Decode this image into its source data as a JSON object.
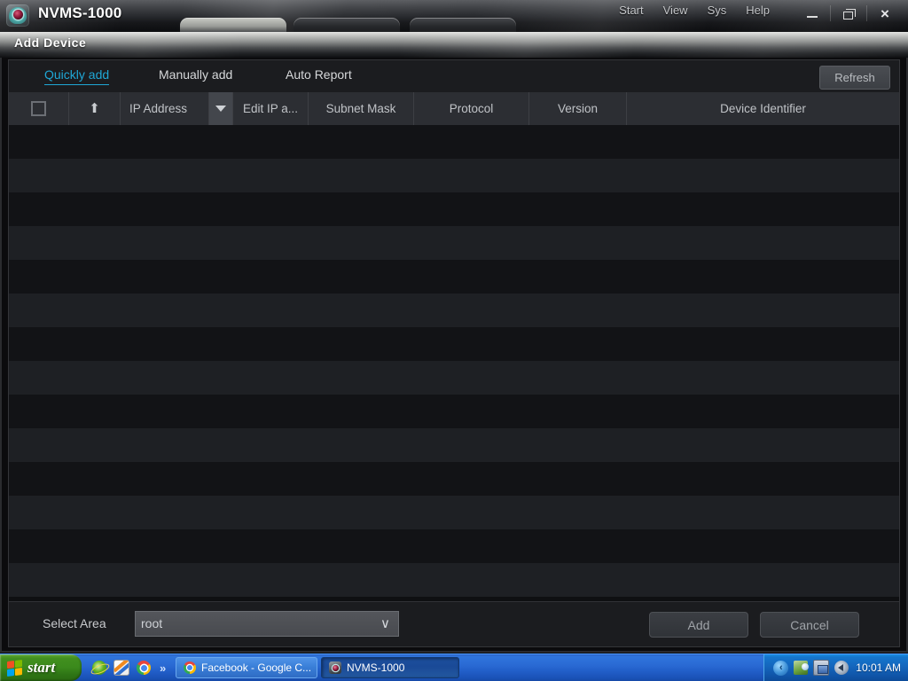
{
  "app": {
    "title": "NVMS-1000",
    "icon": "camera-icon",
    "menu": [
      {
        "label": "Start"
      },
      {
        "label": "View"
      },
      {
        "label": "Sys"
      },
      {
        "label": "Help"
      }
    ],
    "window_controls": {
      "minimize": "minimize-icon",
      "restore": "restore-icon",
      "close": "×"
    }
  },
  "dialog": {
    "title": "Add Device",
    "tabs": [
      {
        "label": "Quickly add",
        "active": true
      },
      {
        "label": "Manually add",
        "active": false
      },
      {
        "label": "Auto Report",
        "active": false
      }
    ],
    "refresh_label": "Refresh",
    "table": {
      "columns": [
        {
          "label": "",
          "name": "select-all-checkbox"
        },
        {
          "label": "",
          "name": "sort-ascending-icon"
        },
        {
          "label": "IP Address",
          "name": "ip-address"
        },
        {
          "label": "",
          "name": "ip-address-filter-chevron"
        },
        {
          "label": "Edit IP a...",
          "name": "edit-ip-address"
        },
        {
          "label": "Subnet Mask",
          "name": "subnet-mask"
        },
        {
          "label": "Protocol",
          "name": "protocol"
        },
        {
          "label": "Version",
          "name": "version"
        },
        {
          "label": "Device Identifier",
          "name": "device-identifier"
        }
      ],
      "rows": [],
      "row_count_visible": 14,
      "empty": true
    },
    "footer": {
      "select_area_label": "Select Area",
      "select_area_value": "root",
      "select_area_chevron": "∨",
      "add_label": "Add",
      "cancel_label": "Cancel"
    }
  },
  "taskbar": {
    "start_label": "start",
    "quick_launch": [
      {
        "name": "internet-explorer-icon"
      },
      {
        "name": "paint-icon"
      },
      {
        "name": "chrome-icon"
      }
    ],
    "quick_launch_more": "»",
    "tasks": [
      {
        "label": "Facebook - Google C...",
        "icon": "chrome-icon",
        "active": false
      },
      {
        "label": "NVMS-1000",
        "icon": "camera-icon",
        "active": true
      }
    ],
    "tray": {
      "expand": "‹",
      "icons": [
        {
          "name": "safely-remove-hardware-icon"
        },
        {
          "name": "network-connection-icon"
        },
        {
          "name": "volume-icon"
        }
      ],
      "clock": "10:01 AM"
    }
  },
  "colors": {
    "accent_cyan": "#1fa7d6",
    "dialog_bg": "#161719",
    "table_header_bg": "#2c2e33",
    "row_odd": "#121316",
    "row_even": "#1e2024",
    "taskbar_blue": "#2f75dc",
    "start_green": "#418f1e"
  }
}
